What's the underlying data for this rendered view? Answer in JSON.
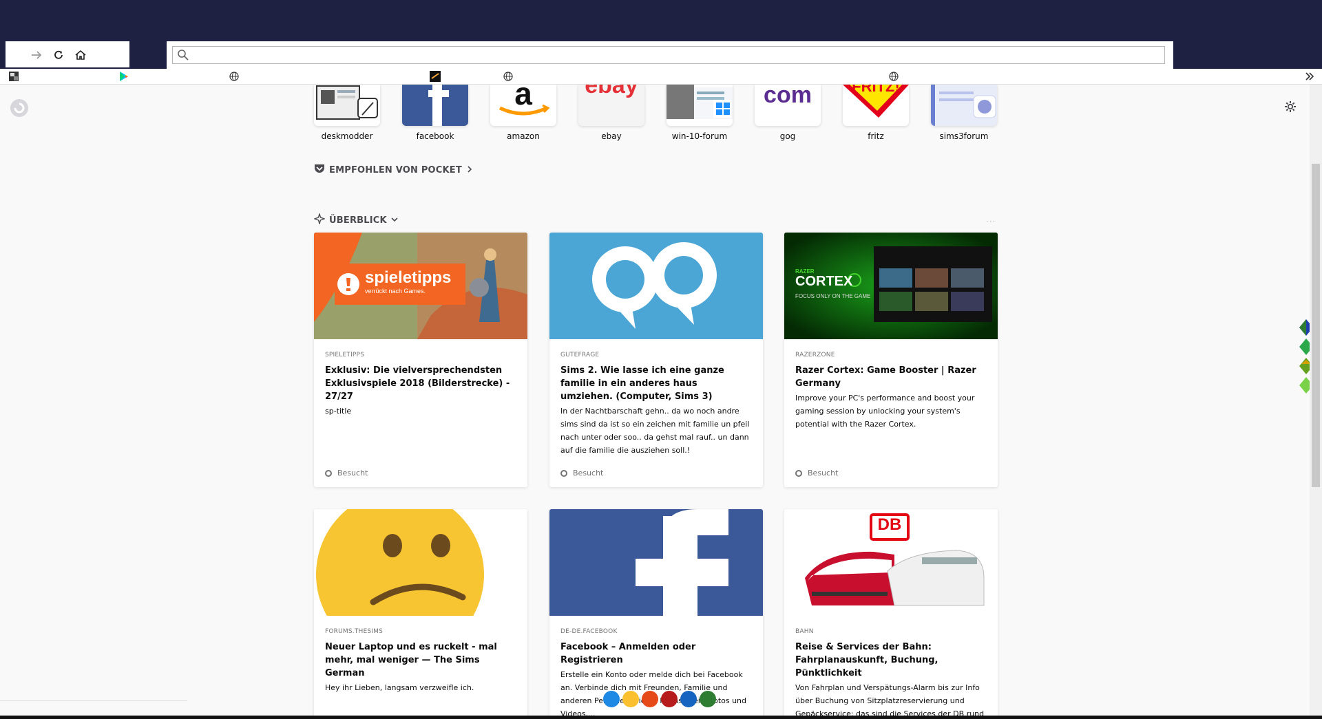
{
  "search": {
    "placeholder": "",
    "value": ""
  },
  "top_sites": [
    {
      "label": "deskmodder"
    },
    {
      "label": "facebook"
    },
    {
      "label": "amazon"
    },
    {
      "label": "ebay"
    },
    {
      "label": "win-10-forum"
    },
    {
      "label": "gog"
    },
    {
      "label": "fritz"
    },
    {
      "label": "sims3forum"
    }
  ],
  "top_site_logos": {
    "amazon": "a",
    "ebay": "ebay",
    "gog": "com",
    "fritz": "FRITZ!"
  },
  "sections": {
    "pocket": "EMPFOHLEN VON POCKET",
    "overview": "ÜBERBLICK"
  },
  "cards": [
    {
      "source": "SPIELETIPPS",
      "title": "Exklusiv: Die vielversprechendsten Exklusivspiele 2018 (Bilderstrecke) - 27/27",
      "desc": "sp-title",
      "footer": "Besucht",
      "image_text": {
        "brand": "spieletipps",
        "tagline": "verrückt nach Games."
      }
    },
    {
      "source": "GUTEFRAGE",
      "title": "Sims 2. Wie lasse ich eine ganze familie in ein anderes haus umziehen. (Computer, Sims 3)",
      "desc": "In der Nachtbarschaft gehn.. da wo noch andre sims sind da ist so ein zeichen mit familie un pfeil nach unter oder soo.. da gehst mal rauf.. un dann auf die familie die ausziehen soll.!",
      "footer": "Besucht"
    },
    {
      "source": "RAZERZONE",
      "title": "Razer Cortex: Game Booster | Razer Germany",
      "desc": "Improve your PC's performance and boost your gaming session by unlocking your system's potential with the Razer Cortex.",
      "footer": "Besucht",
      "image_text": {
        "brand_small": "RAZER",
        "brand": "CORTEX",
        "tagline": "FOCUS ONLY ON THE GAME"
      }
    },
    {
      "source": "FORUMS.THESIMS",
      "title": "Neuer Laptop und es ruckelt - mal mehr, mal weniger — The Sims German",
      "desc": "Hey ihr Lieben, langsam verzweifle ich.",
      "footer": ""
    },
    {
      "source": "DE-DE.FACEBOOK",
      "title": "Facebook – Anmelden oder Registrieren",
      "desc": "Erstelle ein Konto oder melde dich bei Facebook an. Verbinde dich mit Freunden, Familie und anderen Personen, die du kennst. Teile Fotos und Videos,...",
      "footer": ""
    },
    {
      "source": "BAHN",
      "title": "Reise & Services der Bahn: Fahrplanauskunft, Buchung, Pünktlichkeit",
      "desc": "Von Fahrplan und Verspätungs-Alarm bis zur Info über Buchung von Sitzplatzreservierung und Gepäckservice: das sind die Services der DB rund um Ihre Zugreise.",
      "footer": "",
      "image_text": {
        "brand": "DB"
      }
    }
  ],
  "colors": {
    "titlebar": "#1e2142",
    "spieletipps_orange": "#f26522",
    "gutefrage_blue": "#4ba6d6",
    "razer_green": "#0a7a0a",
    "facebook_blue": "#3b5998",
    "db_red": "#e30613"
  },
  "icons": [
    "forward-icon",
    "reload-icon",
    "home-icon",
    "search-icon",
    "settings-gear-icon",
    "overflow-chevron-icon",
    "pocket-icon",
    "highlights-icon"
  ]
}
